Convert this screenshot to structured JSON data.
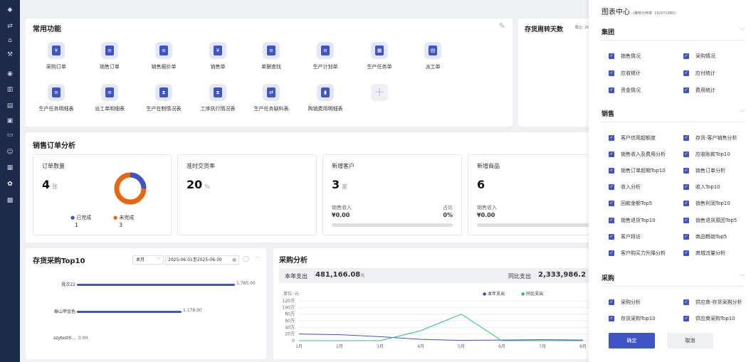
{
  "sidebar": {
    "icons": [
      "home-icon",
      "flow-icon",
      "factory-icon",
      "chart-icon",
      "cart-icon",
      "stats-icon",
      "doc-icon",
      "save-icon",
      "folder-icon",
      "users-icon",
      "report-icon",
      "settings-icon",
      "dashboard-icon"
    ]
  },
  "common": {
    "title": "常用功能",
    "items": [
      {
        "label": "采购订单",
        "glyph": "¥"
      },
      {
        "label": "销售订单",
        "glyph": "≡"
      },
      {
        "label": "销售报价单",
        "glyph": "≡"
      },
      {
        "label": "销售单",
        "glyph": "¥"
      },
      {
        "label": "单据查找",
        "glyph": "≡"
      },
      {
        "label": "生产计划单",
        "glyph": "≡"
      },
      {
        "label": "生产任务单",
        "glyph": "▦"
      },
      {
        "label": "派工单",
        "glyph": "▤"
      },
      {
        "label": "生产任务明细表",
        "glyph": "≡"
      },
      {
        "label": "派工单明细表",
        "glyph": "≡"
      },
      {
        "label": "生产在制情况表",
        "glyph": "⧗"
      },
      {
        "label": "工序执行情况表",
        "glyph": "⧗"
      },
      {
        "label": "生产任务缺料表",
        "glyph": "⇄"
      },
      {
        "label": "购销费用明细表",
        "glyph": "▮"
      }
    ]
  },
  "inventory_turnover": {
    "title": "存货周转天数",
    "note": "截止: 202"
  },
  "sales": {
    "title": "销售订单分析",
    "orders": {
      "label": "订单数量",
      "value": "4",
      "unit": "张",
      "legend_done": "已完成",
      "legend_undone": "未完成",
      "done": "1",
      "undone": "3",
      "done_color": "#3f55c4",
      "undone_color": "#e8660d"
    },
    "ontime": {
      "label": "准时交货率",
      "value": "20",
      "unit": "%"
    },
    "new_customers": {
      "label": "新增客户",
      "value": "3",
      "unit": "家",
      "rev_label": "销售收入",
      "rev_value": "¥0.00",
      "share_label": "占比",
      "share_value": "0%"
    },
    "new_products": {
      "label": "新增商品",
      "value": "6",
      "rev_label": "销售收入",
      "rev_value": "¥0.00"
    }
  },
  "top10": {
    "title": "存货采购Top10",
    "period": "本月",
    "range": "2025-06-01至2025-06-30",
    "items": [
      {
        "name": "批次22",
        "value": "1,785.00",
        "v": 1785
      },
      {
        "name": "泰山甲金色",
        "value": "1,178.00",
        "v": 1178
      },
      {
        "name": "szytest0...",
        "value": "0.00",
        "v": 0
      }
    ]
  },
  "purchase": {
    "title": "采购分析",
    "year_label": "本年支出",
    "year_value": "481,166.08",
    "year_unit": "元",
    "yoy_label": "同比支出",
    "yoy_value": "2,333,986.2",
    "unit_label": "单位: 元",
    "legend_a": "本年支出",
    "legend_b": "同比支出"
  },
  "chart_data": {
    "type": "line",
    "categories": [
      "1月",
      "2月",
      "3月",
      "4月",
      "5月",
      "6月",
      "7月",
      "8月"
    ],
    "y_ticks": [
      "120万",
      "100万",
      "80万",
      "60万",
      "40万",
      "20万",
      "0"
    ],
    "ylim": [
      0,
      1200000
    ],
    "series": [
      {
        "name": "本年支出",
        "color": "#3f55c4",
        "values": [
          200000,
          180000,
          120000,
          40000,
          10000,
          20000,
          30000,
          20000
        ]
      },
      {
        "name": "同比支出",
        "color": "#2cbf8a",
        "values": [
          0,
          0,
          0,
          300000,
          800000,
          0,
          0,
          0
        ]
      }
    ]
  },
  "panel": {
    "title": "图表中心",
    "hint": "(推荐分辨率: 1920*1080)",
    "confirm": "确定",
    "cancel": "取消",
    "sections": [
      {
        "name": "集团",
        "items": [
          "销售情况",
          "采购情况",
          "应收统计",
          "应付统计",
          "资金情况",
          "费用统计"
        ]
      },
      {
        "name": "销售",
        "items": [
          "客户信用超额度",
          "存货-客户销售分析",
          "销售收入及费用分析",
          "应收账款Top10",
          "销售订单超期Top10",
          "销售订单分析",
          "收入分析",
          "收入Top10",
          "回款金额Top5",
          "销售利润Top10",
          "销售退货Top10",
          "销售退货原因Top5",
          "客户拜访",
          "商品畅销Top5",
          "客户购买力升降分析",
          "商城流量分析"
        ]
      },
      {
        "name": "采购",
        "items": [
          "采购分析",
          "供应商-存货采购分析",
          "存货采购Top10",
          "供应商采购Top10"
        ]
      }
    ]
  }
}
